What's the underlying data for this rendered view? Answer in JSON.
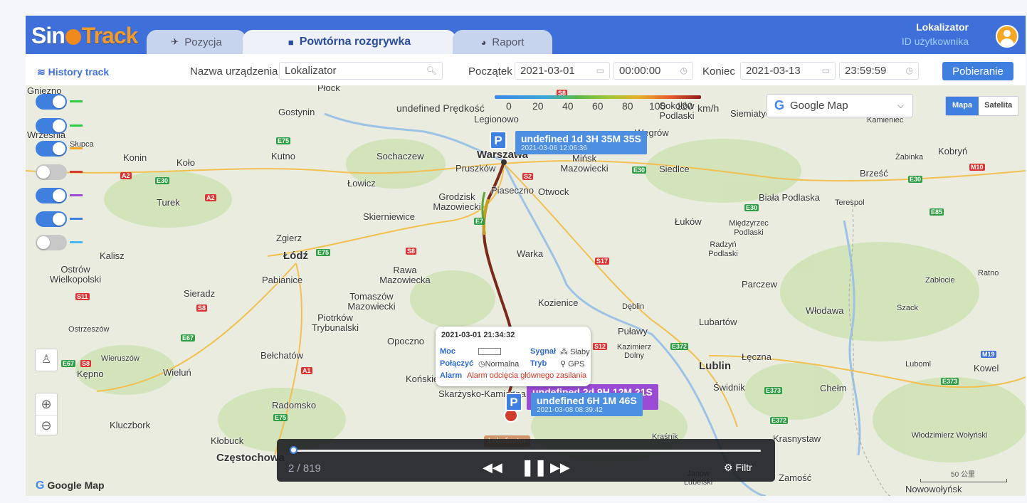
{
  "header": {
    "logo_sin": "Sin",
    "logo_track": "Track",
    "tabs": [
      {
        "label": "Pozycja",
        "icon": "paper-plane-icon"
      },
      {
        "label": "Powtórna rozgrywka",
        "icon": "video-camera-icon"
      },
      {
        "label": "Raport",
        "icon": "pie-chart-icon"
      }
    ],
    "user_name": "Lokalizator",
    "user_id_label": "ID użytkownika"
  },
  "toolbar": {
    "history_label": "History track",
    "device_label": "Nazwa urządzenia",
    "device_value": "Lokalizator",
    "start_label": "Początek",
    "start_date": "2021-03-01",
    "start_time": "00:00:00",
    "end_label": "Koniec",
    "end_date": "2021-03-13",
    "end_time": "23:59:59",
    "download_label": "Pobieranie"
  },
  "map": {
    "speed_prefix": "undefined Prędkość",
    "speed_ticks": [
      "0",
      "20",
      "40",
      "60",
      "80",
      "100",
      "120"
    ],
    "speed_unit": "km/h",
    "provider_label": "Google Map",
    "map_type_map": "Mapa",
    "map_type_sat": "Satelita",
    "layer_colors": [
      "#2ecc40",
      "#2ecc40",
      "#f5a623",
      "#d33c2c",
      "#9b4ad6",
      "#3f7fe0",
      "#48b6f0"
    ],
    "layer_on": [
      true,
      true,
      true,
      false,
      true,
      true,
      false
    ],
    "google_logo": "Google Map",
    "scale_label": "50 公里",
    "marker_label": "Lokalizator",
    "cities": [
      "Gniezno",
      "Września",
      "Słupca",
      "Konin",
      "Koło",
      "Gostynin",
      "Płock",
      "Kutno",
      "Sochaczew",
      "Warszawa",
      "Pruszków",
      "Łowicz",
      "Grodzisk Mazowiecki",
      "Piaseczno",
      "Otwock",
      "Legionowo",
      "Mińsk Mazowiecki",
      "Siedlce",
      "Węgrów",
      "Sokołów Podlaski",
      "Siemiatycze",
      "Kamieniec",
      "Żabinka",
      "Kobryń",
      "Brześć",
      "Biała Podlaska",
      "Terespol",
      "Łuków",
      "Międzyrzec Podlaski",
      "Radzyń Podlaski",
      "Turek",
      "Kalisz",
      "Zgierz",
      "Łódź",
      "Skierniewice",
      "Rawa Mazowiecka",
      "Warka",
      "Ostrów Wielkopolski",
      "Pabianice",
      "Sieradz",
      "Tomaszów Mazowiecki",
      "Kozienice",
      "Dęblin",
      "Parczew",
      "Włodawa",
      "Piotrków Trybunalski",
      "Opoczno",
      "Puławy",
      "Lubartów",
      "Ostrzeszów",
      "Wieruszów",
      "Kępno",
      "Wieluń",
      "Bełchatów",
      "Końskie",
      "Kazimierz Dolny",
      "Łęczna",
      "Lublin",
      "Świdnik",
      "Chełm",
      "Skarżysko-Kamienna",
      "Radomsko",
      "Kluczbork",
      "Kłobuck",
      "Częstochowa",
      "Kraśnik",
      "Krasnystaw",
      "Zamość",
      "Janów Lubelski",
      "Kowel",
      "Luboml",
      "Szack",
      "Ratno",
      "Zabłocie",
      "Włodzimierz Wołyński",
      "Nowowołyńsk",
      "Warszawa",
      "Parczew"
    ],
    "parking_1": {
      "duration": "undefined 1d 3H 35M 35S",
      "time": "2021-03-06 12:06:36"
    },
    "parking_2": {
      "duration": "undefined 6H 1M 46S",
      "time": "2021-03-08 08:39:42"
    },
    "parking_3": {
      "duration": "undefined 2d 9H 12M 21S"
    },
    "popup": {
      "datetime": "2021-03-01 21:34:32",
      "power_label": "Moc",
      "signal_label": "Sygnał",
      "signal_value": "Słaby",
      "connect_label": "Połączyć",
      "connect_value": "Normalna",
      "mode_label": "Tryb",
      "mode_value": "GPS",
      "alarm_label": "Alarm",
      "alarm_value": "Alarm odcięcia głównego zasilania"
    }
  },
  "player": {
    "counter": "2 / 819",
    "progress": 0.003,
    "filter_label": "Filtr"
  }
}
